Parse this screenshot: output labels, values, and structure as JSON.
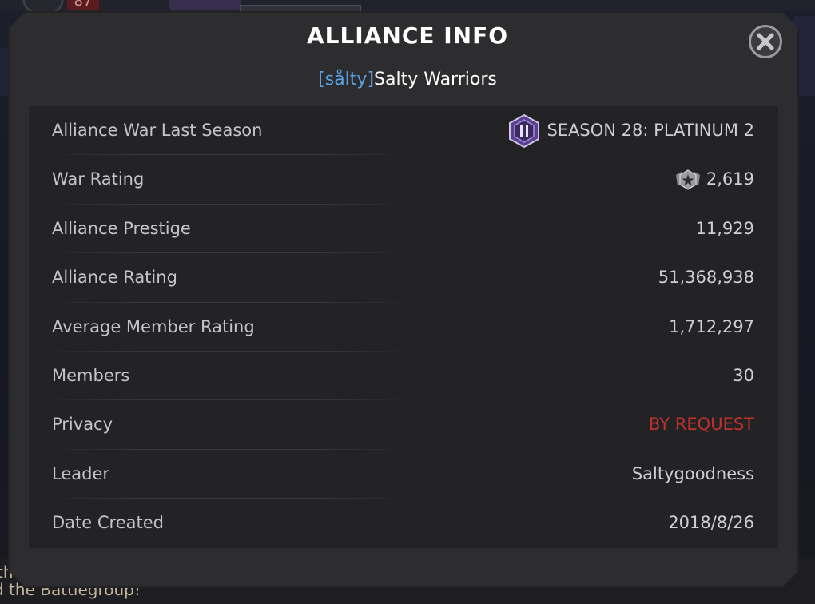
{
  "background": {
    "header_count": "87",
    "footer_line1": "th",
    "footer_line2": "d the Battlegroup!"
  },
  "modal": {
    "title": "ALLIANCE INFO",
    "close_icon": "close-x-icon",
    "alliance_tag": "[sålty]",
    "alliance_name": "Salty Warriors"
  },
  "rows": [
    {
      "label": "Alliance War Last Season",
      "value": "SEASON 28: PLATINUM 2",
      "icon": "platinum-badge-icon"
    },
    {
      "label": "War Rating",
      "value": "2,619",
      "icon": "war-rating-icon"
    },
    {
      "label": "Alliance Prestige",
      "value": "11,929"
    },
    {
      "label": "Alliance Rating",
      "value": "51,368,938"
    },
    {
      "label": "Average Member Rating",
      "value": "1,712,297"
    },
    {
      "label": "Members",
      "value": "30"
    },
    {
      "label": "Privacy",
      "value": "BY REQUEST"
    },
    {
      "label": "Leader",
      "value": "Saltygoodness"
    },
    {
      "label": "Date Created",
      "value": "2018/8/26"
    }
  ],
  "colors": {
    "tag": "#5aa2e6",
    "privacy_value": "#c0312c",
    "panel": "#232325",
    "modal": "#2d2d2f"
  }
}
